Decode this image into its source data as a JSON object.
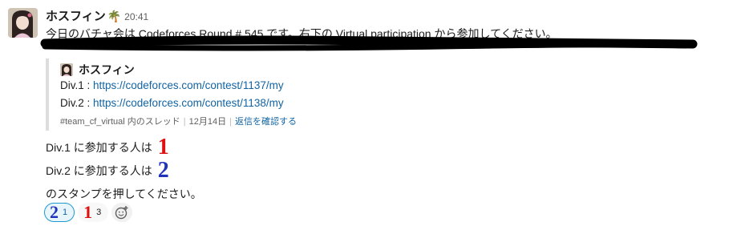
{
  "message": {
    "username": "ホスフィン",
    "status_emoji": "🌴",
    "time": "20:41",
    "text": "今日のバチャ会は Codeforces Round # 545 です。右下の Virtual participation から参加してください。"
  },
  "quote": {
    "author": "ホスフィン",
    "lines": [
      {
        "label": "Div.1 : ",
        "url": "https://codeforces.com/contest/1137/my"
      },
      {
        "label": "Div.2 : ",
        "url": "https://codeforces.com/contest/1138/my"
      }
    ],
    "meta": {
      "channel": "#team_cf_virtual 内のスレッド",
      "date": "12月14日",
      "reply_link": "返信を確認する"
    }
  },
  "lines": {
    "div1": "Div.1 に参加する人は",
    "div1_emoji": "1",
    "div2": "Div.2 に参加する人は",
    "div2_emoji": "2",
    "stamp": "のスタンプを押してください。"
  },
  "reactions": [
    {
      "emoji": "2",
      "count": "1",
      "active": true
    },
    {
      "emoji": "1",
      "count": "3",
      "active": false
    }
  ],
  "colors": {
    "link": "#1264a3",
    "red_digit": "#dd1111",
    "blue_digit": "#2233bb",
    "reaction_active_border": "#1d9bd1"
  },
  "icons": {
    "add_reaction": "add-reaction-icon",
    "avatar": "avatar-image"
  }
}
